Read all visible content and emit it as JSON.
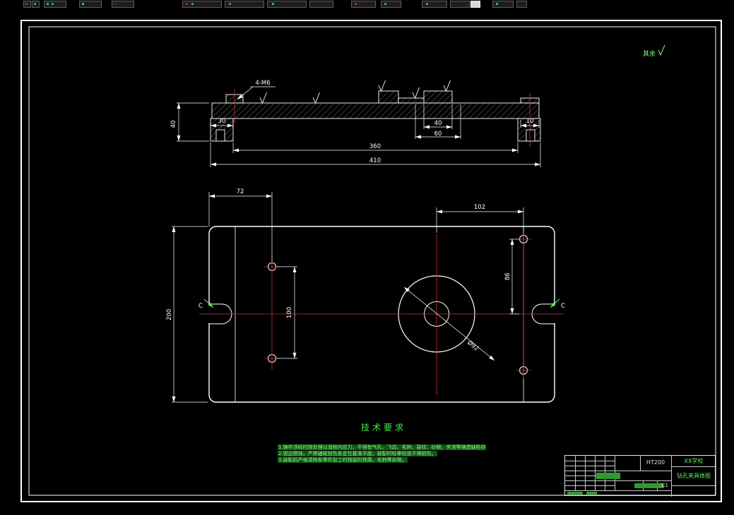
{
  "canvas": {
    "surface_note": "其余",
    "section": {
      "thread_label": "4-M6",
      "dim_left_height": "40",
      "dim_left_foot": "30",
      "dim_right_lip": "10",
      "dim_mid_upper": "40",
      "dim_mid_lower": "60",
      "dim_span_inner": "360",
      "dim_span_outer": "410"
    },
    "plan": {
      "dim_left_hole_offset": "72",
      "dim_right_hole_offset": "102",
      "dim_left_hole_pitch": "100",
      "dim_right_hole_to_center": "86",
      "dim_overall_width": "200",
      "dim_bore": "Ø92",
      "section_mark_left": "C",
      "section_mark_right": "C"
    },
    "tech": {
      "title": "技术要求",
      "lines": [
        "1.铸件须经时效处理以消除内应力，不得有气孔、飞边、毛刺、裂纹、砂眼、夹渣等铸造缺陷存在。",
        "2.锐边倒钝，严禁磕碰划伤各定位基准平面，装配时轻拿轻放不得损伤。",
        "3.装配前严格清除各零件加工时残留的铁屑、毛刺等杂物。"
      ]
    },
    "titleblock": {
      "material": "HT200",
      "school": "XX学校",
      "drawing_name": "钻孔夹具体图",
      "scale": "1:1"
    }
  }
}
